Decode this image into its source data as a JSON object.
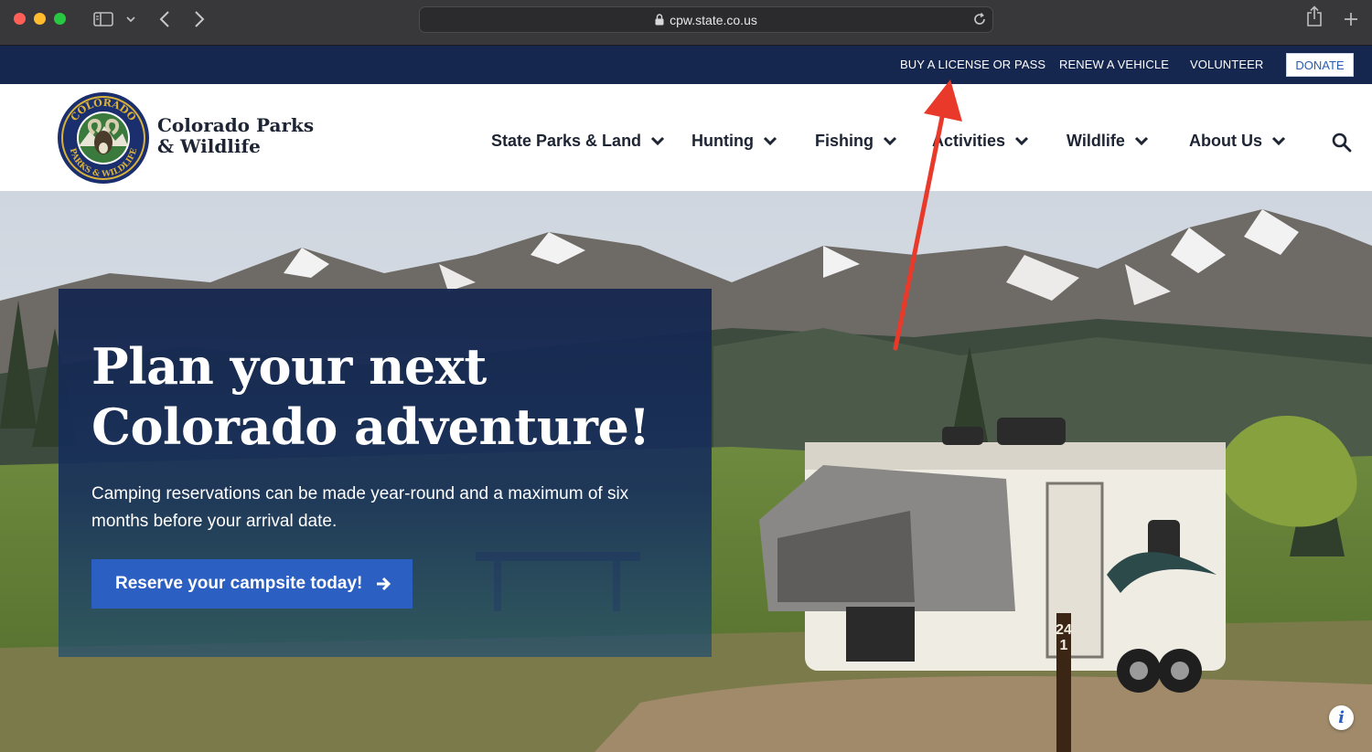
{
  "browser": {
    "url": "cpw.state.co.us",
    "icons": [
      "sidebar-icon",
      "chevron-down-icon",
      "back-icon",
      "forward-icon",
      "lock-icon",
      "reload-icon",
      "share-icon",
      "plus-icon"
    ]
  },
  "utility_nav": {
    "links": [
      "BUY A LICENSE OR PASS",
      "RENEW A VEHICLE",
      "VOLUNTEER"
    ],
    "donate_label": "DONATE"
  },
  "header": {
    "brand_line1": "Colorado Parks",
    "brand_line2": "& Wildlife",
    "logo_text_top": "COLORADO",
    "logo_text_bottom": "PARKS & WILDLIFE",
    "nav": [
      "State Parks & Land",
      "Hunting",
      "Fishing",
      "Activities",
      "Wildlife",
      "About Us"
    ]
  },
  "hero": {
    "title_line1": "Plan your next",
    "title_line2": "Colorado adventure!",
    "text": "Camping reservations can be made year-round and a maximum of six months before your arrival date.",
    "cta_label": "Reserve your campsite today!",
    "camp_marker": "241",
    "info_label": "i"
  },
  "colors": {
    "utility_bar": "#15264f",
    "cta": "#2c5fc2",
    "annotation_arrow": "#e8392b"
  }
}
